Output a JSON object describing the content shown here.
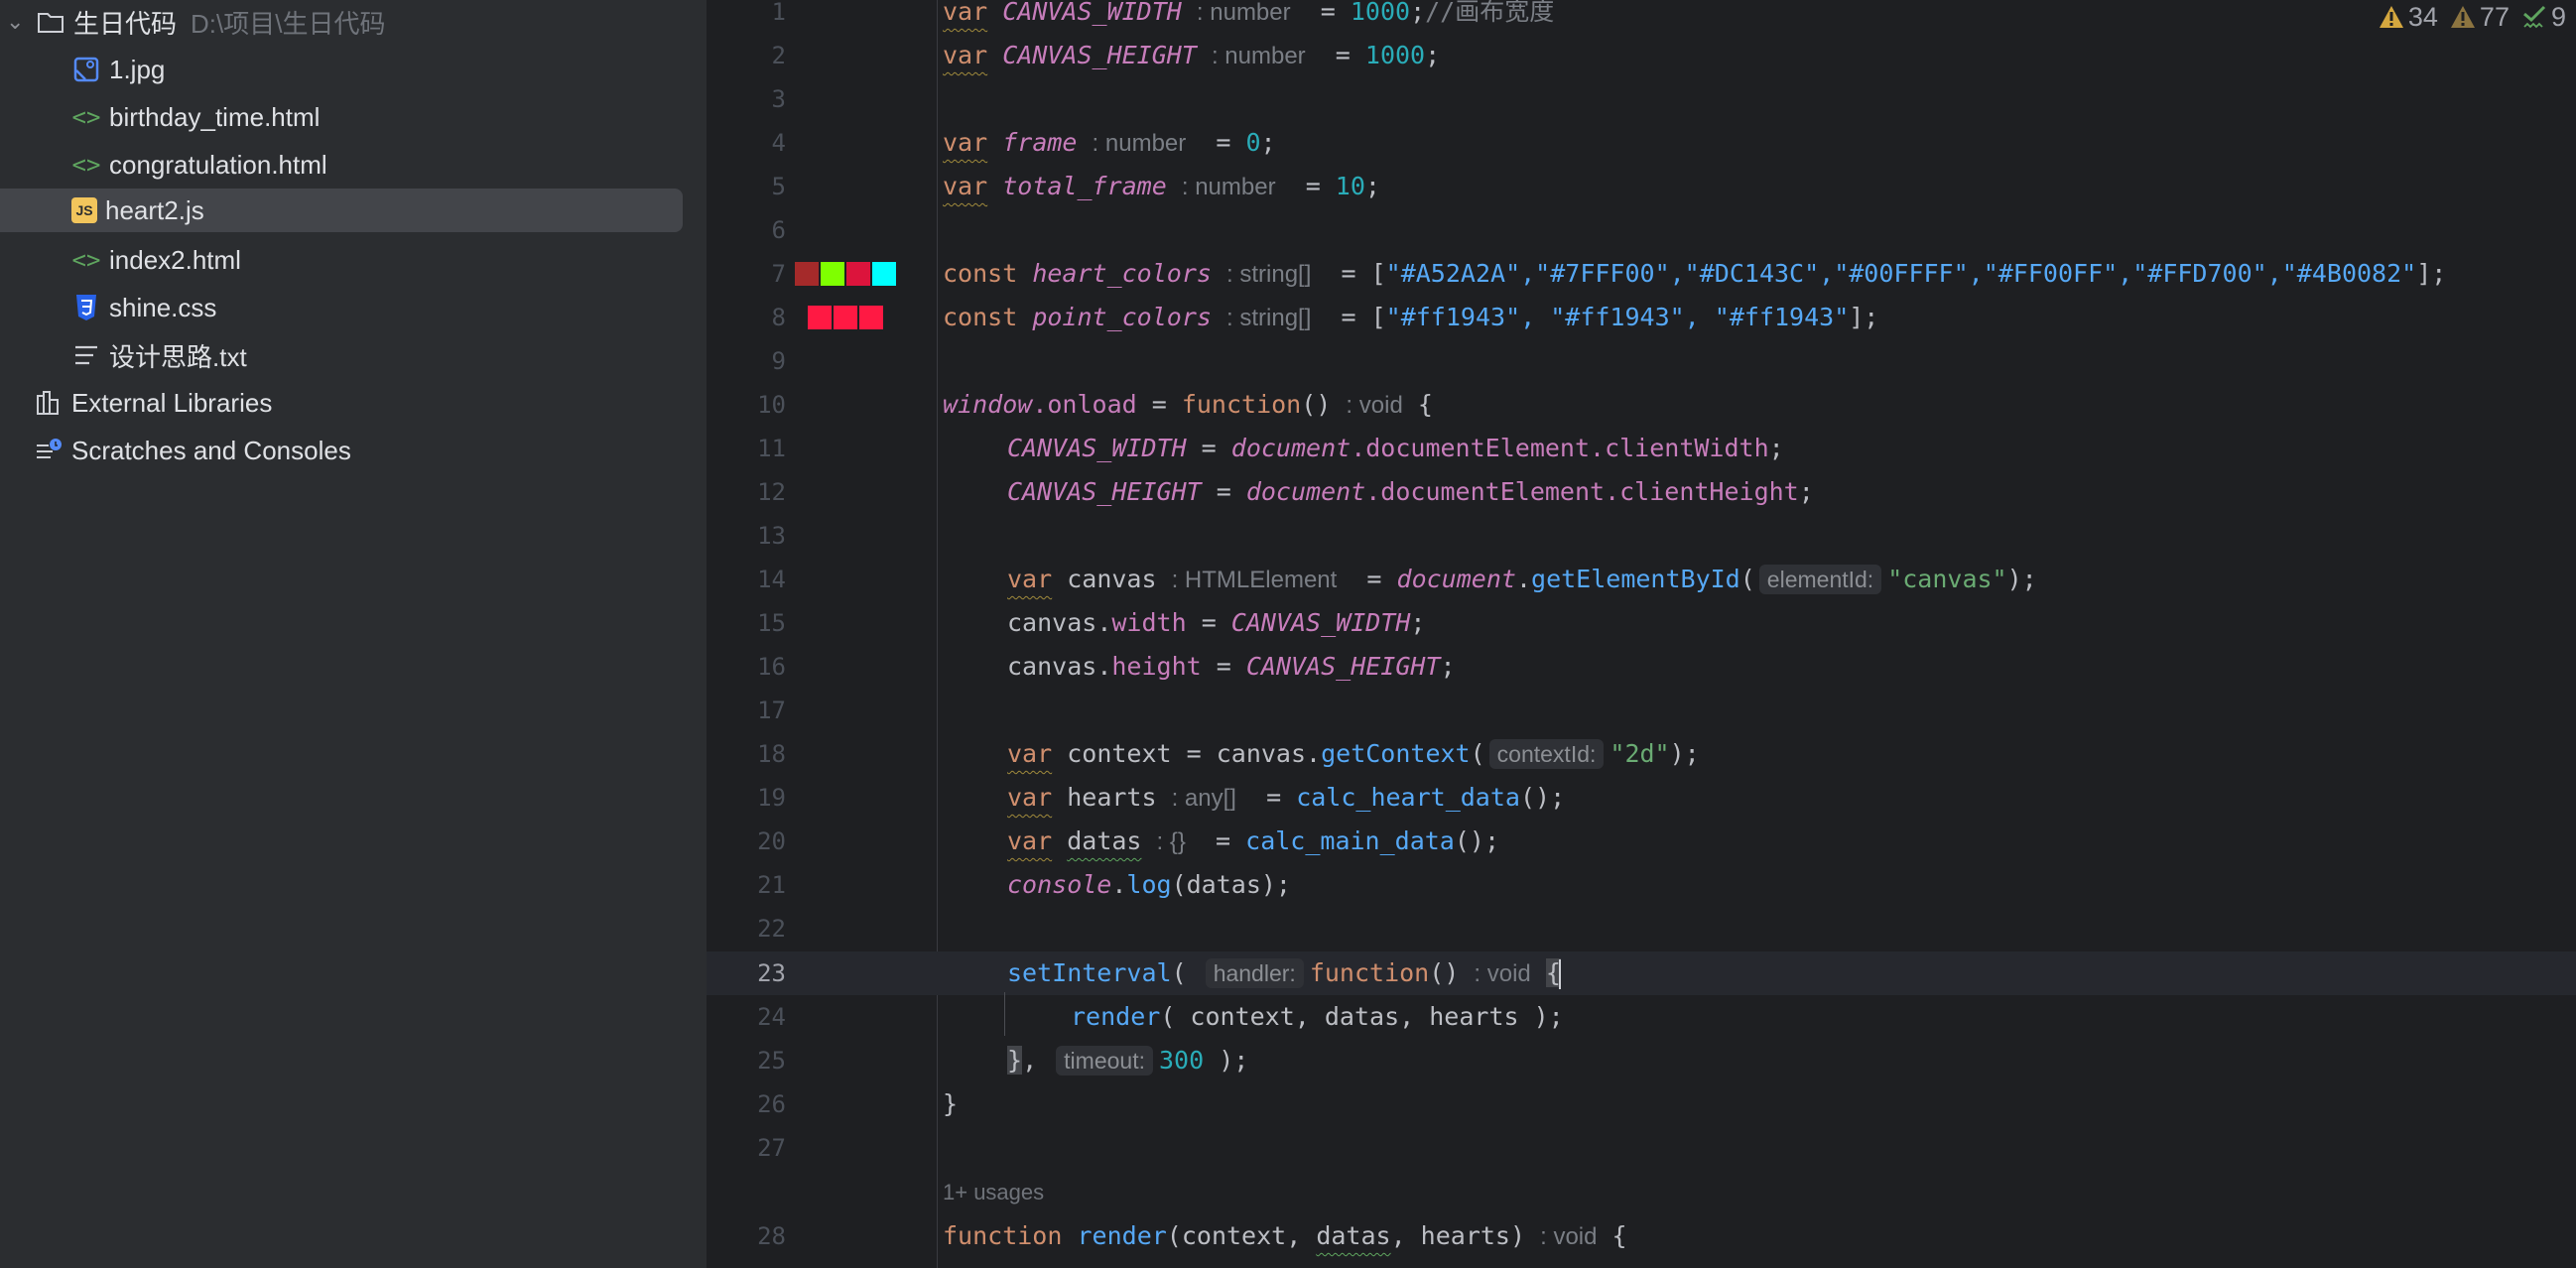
{
  "project": {
    "root_name": "生日代码",
    "root_path": "D:\\项目\\生日代码",
    "files": [
      {
        "name": "1.jpg",
        "type": "image"
      },
      {
        "name": "birthday_time.html",
        "type": "html"
      },
      {
        "name": "congratulation.html",
        "type": "html"
      },
      {
        "name": "heart2.js",
        "type": "js",
        "selected": true
      },
      {
        "name": "index2.html",
        "type": "html"
      },
      {
        "name": "shine.css",
        "type": "css"
      },
      {
        "name": "设计思路.txt",
        "type": "text"
      }
    ],
    "external_libraries": "External Libraries",
    "scratches": "Scratches and Consoles"
  },
  "status": {
    "warnings": "34",
    "weak_warnings": "77",
    "typos": "9"
  },
  "editor": {
    "current_line": 23,
    "usages_hint": "1+ usages",
    "heart_colors": [
      "#A52A2A",
      "#7FFF00",
      "#DC143C",
      "#00FFFF"
    ],
    "point_colors": [
      "#ff1943",
      "#ff1943",
      "#ff1943"
    ],
    "line_numbers": [
      "1",
      "2",
      "3",
      "4",
      "5",
      "6",
      "7",
      "8",
      "9",
      "10",
      "11",
      "12",
      "13",
      "14",
      "15",
      "16",
      "17",
      "18",
      "19",
      "20",
      "21",
      "22",
      "23",
      "24",
      "25",
      "26",
      "27",
      "28"
    ],
    "tokens": {
      "l1": {
        "kw": "var",
        "name": "CANVAS_WIDTH",
        "hint": ": number",
        "eq": " = ",
        "num": "1000",
        "semi": ";",
        "comment": "//画布宽度"
      },
      "l2": {
        "kw": "var",
        "name": "CANVAS_HEIGHT",
        "hint": ": number",
        "eq": " = ",
        "num": "1000",
        "semi": ";"
      },
      "l4": {
        "kw": "var",
        "name": "frame",
        "hint": ": number",
        "eq": " = ",
        "num": "0",
        "semi": ";"
      },
      "l5": {
        "kw": "var",
        "name": "total_frame",
        "hint": ": number",
        "eq": " = ",
        "num": "10",
        "semi": ";"
      },
      "l7": {
        "kw": "const",
        "name": "heart_colors",
        "hint": ": string[]",
        "eq": " = [",
        "values": "\"#A52A2A\",\"#7FFF00\",\"#DC143C\",\"#00FFFF\",\"#FF00FF\",\"#FFD700\",\"#4B0082\"",
        "end": "];"
      },
      "l8": {
        "kw": "const",
        "name": "point_colors",
        "hint": ": string[]",
        "eq": " = [",
        "values": "\"#ff1943\", \"#ff1943\", \"#ff1943\"",
        "end": "];"
      },
      "l10": {
        "obj": "window",
        "prop": ".onload",
        "eq": " = ",
        "kw": "function",
        "paren": "()",
        "hint": ": void",
        "brace": " {"
      },
      "l11": {
        "name": "CANVAS_WIDTH",
        "eq": " = ",
        "obj": "document",
        "chain": ".documentElement.clientWidth",
        "semi": ";"
      },
      "l12": {
        "name": "CANVAS_HEIGHT",
        "eq": " = ",
        "obj": "document",
        "chain": ".documentElement.clientHeight",
        "semi": ";"
      },
      "l14": {
        "kw": "var",
        "name": "canvas",
        "hint": ": HTMLElement",
        "eq": " = ",
        "obj": "document",
        "dot": ".",
        "fn": "getElementById",
        "open": "(",
        "param": "elementId:",
        "str": "\"canvas\"",
        "close": ");"
      },
      "l15": {
        "obj": "canvas",
        "dot": ".",
        "prop": "width",
        "eq": " = ",
        "name": "CANVAS_WIDTH",
        "semi": ";"
      },
      "l16": {
        "obj": "canvas",
        "dot": ".",
        "prop": "height",
        "eq": " = ",
        "name": "CANVAS_HEIGHT",
        "semi": ";"
      },
      "l18": {
        "kw": "var",
        "name": "context",
        "eq": " = canvas.",
        "fn": "getContext",
        "open": "(",
        "param": "contextId:",
        "str": "\"2d\"",
        "close": ");"
      },
      "l19": {
        "kw": "var",
        "name": "hearts",
        "hint": ": any[]",
        "eq": " = ",
        "fn": "calc_heart_data",
        "close": "();"
      },
      "l20": {
        "kw": "var",
        "name": "datas",
        "hint": ": {}",
        "eq": " = ",
        "fn": "calc_main_data",
        "close": "();"
      },
      "l21": {
        "obj": "console",
        "dot": ".",
        "fn": "log",
        "rest": "(datas);"
      },
      "l23": {
        "fn": "setInterval",
        "open": "( ",
        "param": "handler:",
        "kw": "function",
        "paren": "()",
        "hint": ": void",
        "brace": "{"
      },
      "l24": {
        "fn": "render",
        "rest": "( context, datas, hearts );"
      },
      "l25": {
        "brace": "}",
        "comma": ", ",
        "param": "timeout:",
        "num": "300",
        "close": " );"
      },
      "l26": {
        "brace": "}"
      },
      "l28": {
        "kw": "function",
        "fn": "render",
        "p1": "(context, ",
        "p2": "datas",
        "p3": ", hearts)",
        "hint": ": void",
        "brace": " {"
      }
    }
  }
}
